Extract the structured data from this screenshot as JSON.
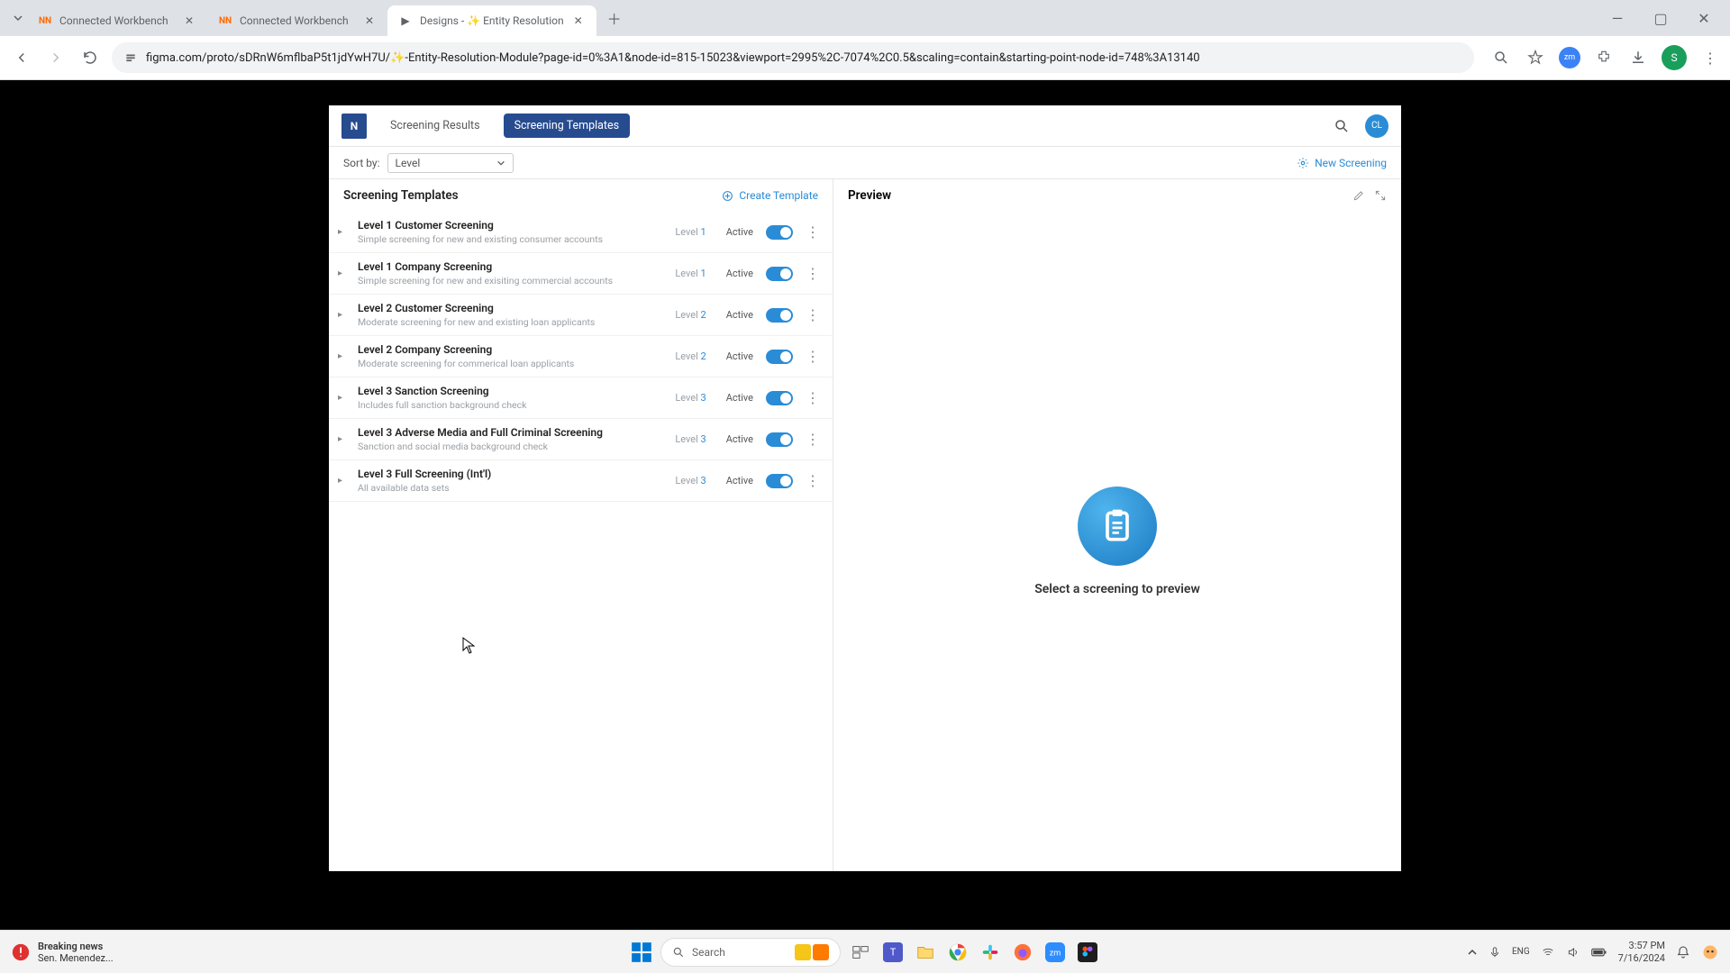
{
  "browser": {
    "tabs": [
      {
        "title": "Connected Workbench",
        "favicon": "NN"
      },
      {
        "title": "Connected Workbench",
        "favicon": "NN"
      },
      {
        "title": "Designs - ✨ Entity Resolution",
        "favicon": "▶"
      }
    ],
    "url": "figma.com/proto/sDRnW6mflbaP5t1jdYwH7U/✨-Entity-Resolution-Module?page-id=0%3A1&node-id=815-15023&viewport=2995%2C-7074%2C0.5&scaling=contain&starting-point-node-id=748%3A13140",
    "profile_initial": "S"
  },
  "app": {
    "logo_text": "N",
    "header_tabs": [
      {
        "label": "Screening Results",
        "active": false
      },
      {
        "label": "Screening Templates",
        "active": true
      }
    ],
    "user_initials": "CL",
    "sort_label": "Sort by:",
    "sort_value": "Level",
    "new_screening_label": "New Screening",
    "list_title": "Screening Templates",
    "create_template_label": "Create Template",
    "preview_title": "Preview",
    "preview_empty_text": "Select a screening to preview",
    "status_active": "Active",
    "level_prefix": "Level",
    "templates": [
      {
        "title": "Level 1 Customer Screening",
        "desc": "Simple screening for new and existing consumer accounts",
        "level": "1"
      },
      {
        "title": "Level 1 Company Screening",
        "desc": "Simple screening for new and exisiting commercial accounts",
        "level": "1"
      },
      {
        "title": "Level 2 Customer Screening",
        "desc": "Moderate screening for new and existing loan applicants",
        "level": "2"
      },
      {
        "title": "Level 2 Company Screening",
        "desc": "Moderate screening for commerical loan applicants",
        "level": "2"
      },
      {
        "title": "Level 3 Sanction Screening",
        "desc": "Includes full sanction background check",
        "level": "3"
      },
      {
        "title": "Level 3 Adverse Media and Full Criminal Screening",
        "desc": "Sanction and social media background check",
        "level": "3"
      },
      {
        "title": "Level 3 Full Screening (Int'l)",
        "desc": "All available data sets",
        "level": "3"
      }
    ]
  },
  "taskbar": {
    "news_title": "Breaking news",
    "news_sub": "Sen. Menendez...",
    "search_placeholder": "Search",
    "time": "3:57 PM",
    "date": "7/16/2024"
  }
}
